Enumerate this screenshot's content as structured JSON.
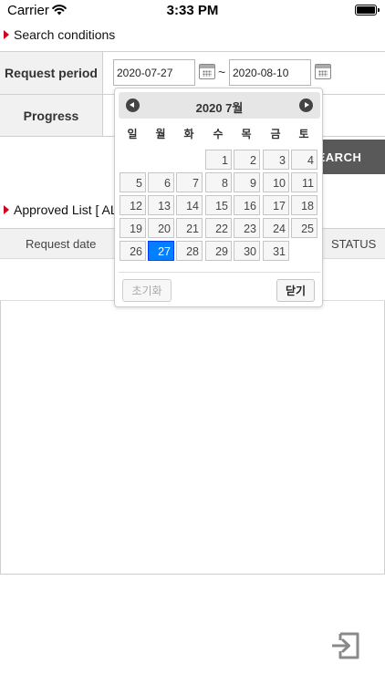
{
  "status_bar": {
    "carrier": "Carrier",
    "time": "3:33 PM"
  },
  "search": {
    "section_title": "Search conditions",
    "request_period_label": "Request period",
    "start_date": "2020-07-27",
    "date_separator": "~",
    "end_date": "2020-08-10",
    "progress_label": "Progress",
    "search_button": "EARCH"
  },
  "list": {
    "section_title": "Approved List [ AL",
    "columns": [
      "Request date",
      "STATUS"
    ]
  },
  "datepicker": {
    "title": "2020 7월",
    "weekdays": [
      "일",
      "월",
      "화",
      "수",
      "목",
      "금",
      "토"
    ],
    "first_weekday_index": 3,
    "days": [
      1,
      2,
      3,
      4,
      5,
      6,
      7,
      8,
      9,
      10,
      11,
      12,
      13,
      14,
      15,
      16,
      17,
      18,
      19,
      20,
      21,
      22,
      23,
      24,
      25,
      26,
      27,
      28,
      29,
      30,
      31
    ],
    "selected_day": 27,
    "reset_label": "초기화",
    "close_label": "닫기"
  },
  "colors": {
    "accent_red": "#d0021b",
    "selected_blue": "#007fff",
    "search_button_bg": "#595959",
    "header_bg": "#f1f1f1"
  },
  "icons": {
    "logout": "logout-icon",
    "calendar": "calendar-icon"
  }
}
